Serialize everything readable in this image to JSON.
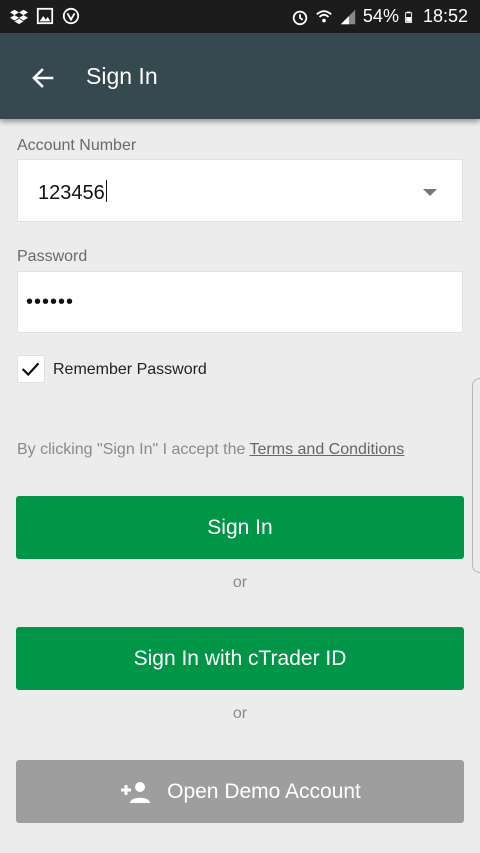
{
  "status_bar": {
    "battery": "54%",
    "time": "18:52",
    "left_icons": [
      "dropbox-icon",
      "image-icon",
      "shield-icon"
    ],
    "right_icons": [
      "alarm-icon",
      "wifi-icon",
      "signal-icon",
      "battery-icon"
    ]
  },
  "app_bar": {
    "title": "Sign In",
    "background": "#364850"
  },
  "form": {
    "account_label": "Account Number",
    "account_value": "123456",
    "password_label": "Password",
    "password_value": "••••••",
    "remember_label": "Remember Password",
    "remember_checked": true
  },
  "terms": {
    "prefix": "By clicking \"Sign In\" I accept the ",
    "link": "Terms and Conditions"
  },
  "buttons": {
    "sign_in": "Sign In",
    "or_1": "or",
    "sign_in_ctrader": "Sign In with cTrader ID",
    "or_2": "or",
    "open_demo": "Open Demo Account"
  },
  "colors": {
    "primary_green": "#019548",
    "demo_gray": "#9e9e9e"
  }
}
